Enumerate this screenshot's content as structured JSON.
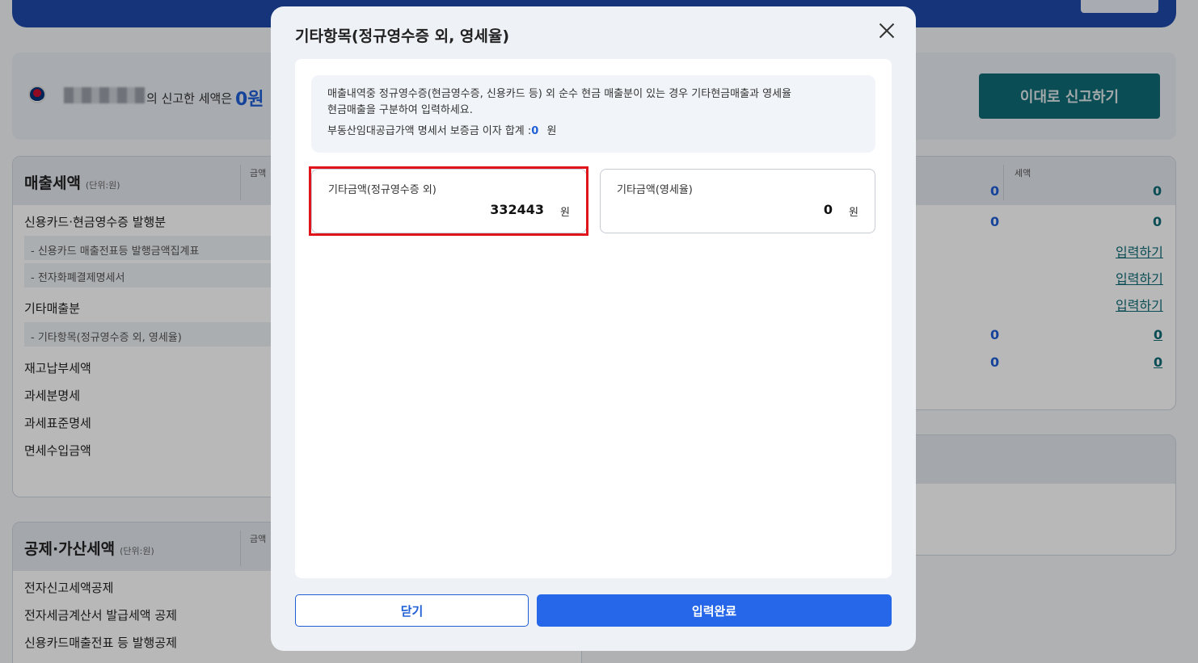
{
  "background": {
    "summary": {
      "message": "의 신고한 세액은",
      "amount": "0원",
      "report_button": "이대로 신고하기"
    },
    "sales_card": {
      "title": "매출세액",
      "unit": "(단위:원)",
      "col_amount": "금액",
      "col_tax": "세액",
      "rows": [
        "신용카드·현금영수증 발행분",
        "- 신용카드 매출전표등 발행금액집계표",
        "- 전자화폐결제명세서",
        "기타매출분",
        "- 기타항목(정규영수증 외, 영세율)",
        "재고납부세액",
        "과세분명세",
        "과세표준명세",
        "면세수입금액"
      ]
    },
    "right_values": {
      "r1_amount": "0",
      "r1_tax": "0",
      "r2_amount": "0",
      "r2_tax": "0",
      "link": "입력하기",
      "r6_amount": "0",
      "r6_tax": "0",
      "r7_amount": "0",
      "r7_tax": "0"
    },
    "deduction_card": {
      "title": "공제·가산세액",
      "unit": "(단위:원)",
      "col_amount": "금액",
      "rows": [
        "전자신고세액공제",
        "전자세금계산서 발급세액 공제",
        "신용카드매출전표 등 발행공제"
      ]
    }
  },
  "modal": {
    "title": "기타항목(정규영수증 외, 영세율)",
    "notice_line1": "매출내역중 정규영수증(현금영수증, 신용카드 등) 외 순수 현금 매출분이 있는 경우 기타현금매출과 영세율",
    "notice_line2": "현금매출을 구분하여 입력하세요.",
    "notice_line3_prefix": "부동산임대공급가액 명세서 보증금 이자 합계 :",
    "notice_line3_value": "0",
    "notice_line3_unit": "원",
    "field_other": {
      "label": "기타금액(정규영수증 외)",
      "value": "332443",
      "unit": "원"
    },
    "field_zero_rate": {
      "label": "기타금액(영세율)",
      "value": "0",
      "unit": "원"
    },
    "close_button": "닫기",
    "done_button": "입력완료"
  }
}
